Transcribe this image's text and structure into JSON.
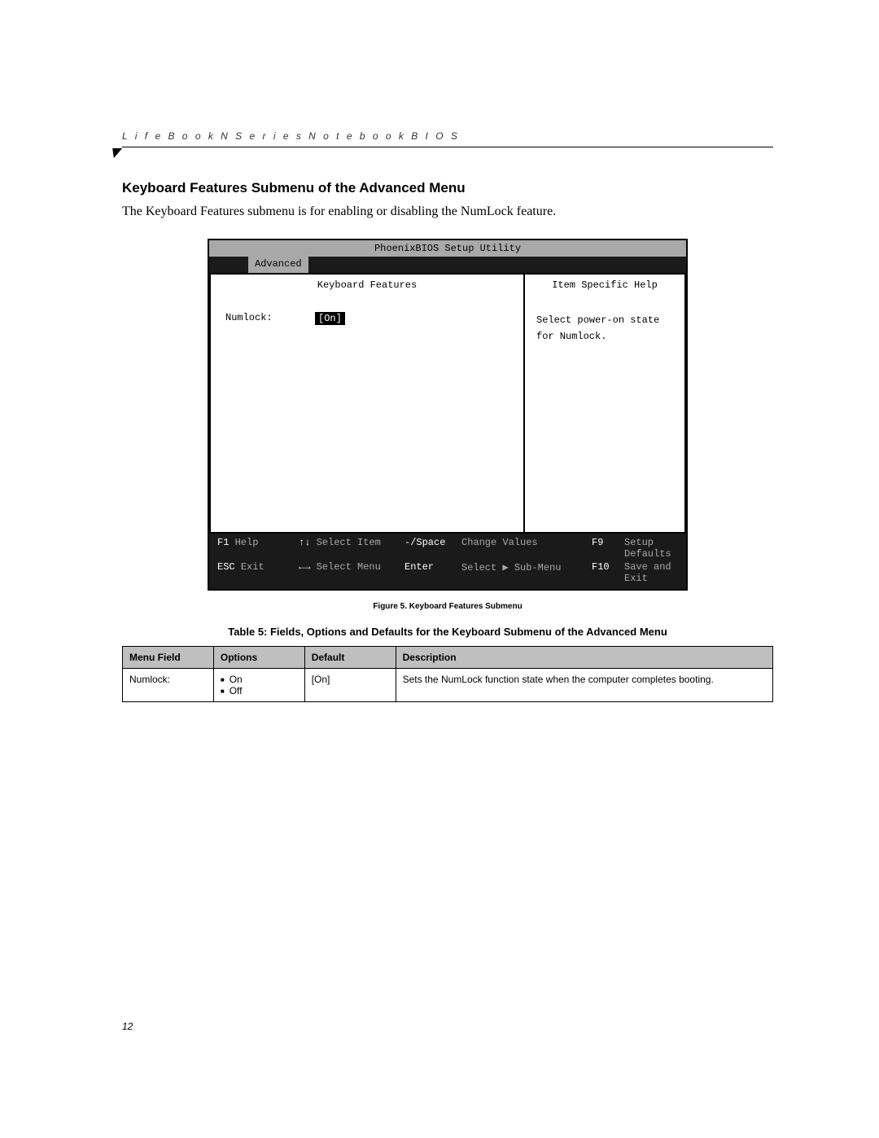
{
  "header": {
    "running": "L i f e B o o k   N   S e r i e s   N o t e b o o k   B I O S"
  },
  "section": {
    "heading": "Keyboard Features Submenu of the Advanced Menu",
    "intro": "The Keyboard Features submenu is for enabling or disabling the NumLock feature."
  },
  "bios": {
    "title": "PhoenixBIOS Setup Utility",
    "active_tab": "Advanced",
    "left_title": "Keyboard Features",
    "right_title": "Item Specific Help",
    "field_label": "Numlock:",
    "field_value": "[On]",
    "help_line1": "Select power-on state",
    "help_line2": "for Numlock.",
    "footer": {
      "f1": "F1",
      "help": "Help",
      "selitem": "Select Item",
      "minusspace": "-/Space",
      "chval": "Change Values",
      "f9": "F9",
      "setupdef": "Setup Defaults",
      "esc": "ESC",
      "exit": "Exit",
      "selmenu": "Select Menu",
      "enter": "Enter",
      "subsel": "Select ▶ Sub-Menu",
      "f10": "F10",
      "saveexit": "Save and Exit"
    }
  },
  "figure": {
    "caption": "Figure 5.  Keyboard Features Submenu",
    "table_title": "Table 5: Fields, Options and Defaults for the Keyboard Submenu of the Advanced Menu"
  },
  "table": {
    "head": {
      "c1": "Menu Field",
      "c2": "Options",
      "c3": "Default",
      "c4": "Description"
    },
    "row": {
      "field": "Numlock:",
      "opt1": "On",
      "opt2": "Off",
      "def": "[On]",
      "desc": "Sets the NumLock function state when the computer completes booting."
    }
  },
  "page_number": "12"
}
